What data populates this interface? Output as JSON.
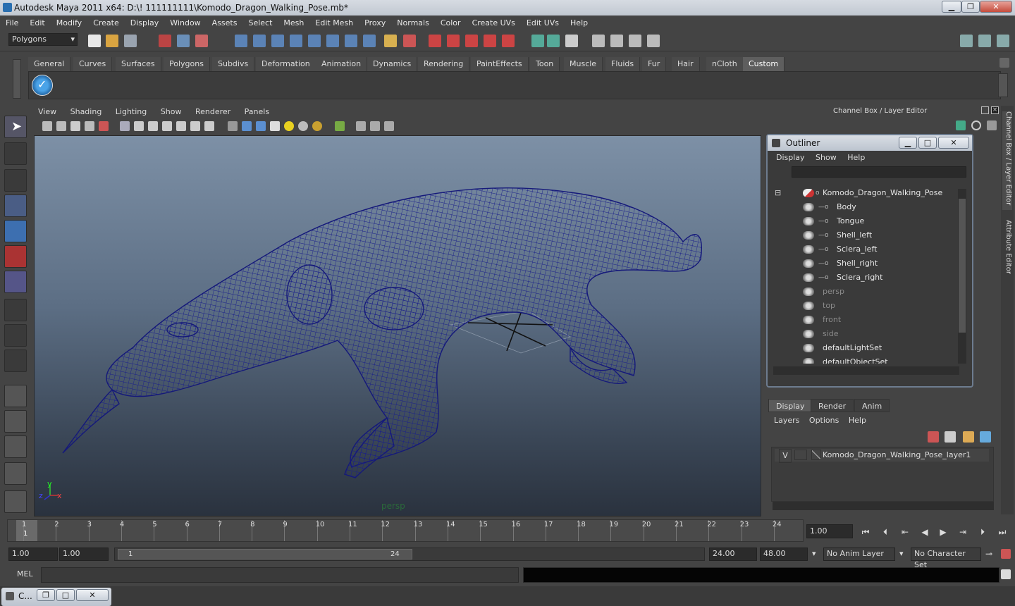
{
  "app": {
    "title": "Autodesk Maya 2011 x64: D:\\! 111111111\\Komodo_Dragon_Walking_Pose.mb*",
    "win_minimize": "▁",
    "win_restore": "❐",
    "win_close": "✕"
  },
  "menubar": [
    "File",
    "Edit",
    "Modify",
    "Create",
    "Display",
    "Window",
    "Assets",
    "Select",
    "Mesh",
    "Edit Mesh",
    "Proxy",
    "Normals",
    "Color",
    "Create UVs",
    "Edit UVs",
    "Help"
  ],
  "statusline": {
    "mode": "Polygons"
  },
  "shelf": {
    "tabs": [
      "General",
      "Curves",
      "Surfaces",
      "Polygons",
      "Subdivs",
      "Deformation",
      "Animation",
      "Dynamics",
      "Rendering",
      "PaintEffects",
      "Toon",
      "Muscle",
      "Fluids",
      "Fur",
      "Hair",
      "nCloth",
      "Custom"
    ],
    "active_tab": "Custom"
  },
  "viewport": {
    "menu": [
      "View",
      "Shading",
      "Lighting",
      "Show",
      "Renderer",
      "Panels"
    ],
    "camera_label": "persp",
    "axis_y": "y",
    "axis_x": "x",
    "axis_z": "z"
  },
  "channel_box": {
    "title": "Channel Box / Layer Editor",
    "side_tab_1": "Channel Box / Layer Editor",
    "side_tab_2": "Attribute Editor"
  },
  "outliner": {
    "title": "Outliner",
    "menu": [
      "Display",
      "Show",
      "Help"
    ],
    "items": [
      {
        "label": "Komodo_Dragon_Walking_Pose",
        "level": 0,
        "dim": false
      },
      {
        "label": "Body",
        "level": 1,
        "dim": false
      },
      {
        "label": "Tongue",
        "level": 1,
        "dim": false
      },
      {
        "label": "Shell_left",
        "level": 1,
        "dim": false
      },
      {
        "label": "Sclera_left",
        "level": 1,
        "dim": false
      },
      {
        "label": "Shell_right",
        "level": 1,
        "dim": false
      },
      {
        "label": "Sclera_right",
        "level": 1,
        "dim": false
      },
      {
        "label": "persp",
        "level": 0,
        "dim": true
      },
      {
        "label": "top",
        "level": 0,
        "dim": true
      },
      {
        "label": "front",
        "level": 0,
        "dim": true
      },
      {
        "label": "side",
        "level": 0,
        "dim": true
      },
      {
        "label": "defaultLightSet",
        "level": 0,
        "dim": false
      },
      {
        "label": "defaultObjectSet",
        "level": 0,
        "dim": false
      }
    ]
  },
  "layer_editor": {
    "tabs": [
      "Display",
      "Render",
      "Anim"
    ],
    "active_tab": "Display",
    "menu": [
      "Layers",
      "Options",
      "Help"
    ],
    "layer_visible": "V",
    "layer_name": "Komodo_Dragon_Walking_Pose_layer1"
  },
  "timeline": {
    "frames": [
      "1",
      "2",
      "3",
      "4",
      "5",
      "6",
      "7",
      "8",
      "9",
      "10",
      "11",
      "12",
      "13",
      "14",
      "15",
      "16",
      "17",
      "18",
      "19",
      "20",
      "21",
      "22",
      "23",
      "24"
    ],
    "current_frame": "1",
    "current_time_field": "1.00"
  },
  "range": {
    "start": "1.00",
    "playback_start": "1.00",
    "slider_start": "1",
    "slider_end": "24",
    "playback_end": "24.00",
    "end": "48.00",
    "anim_layer": "No Anim Layer",
    "character_set": "No Character Set"
  },
  "command_line": {
    "label": "MEL"
  },
  "taskbar": {
    "item": "C..."
  }
}
